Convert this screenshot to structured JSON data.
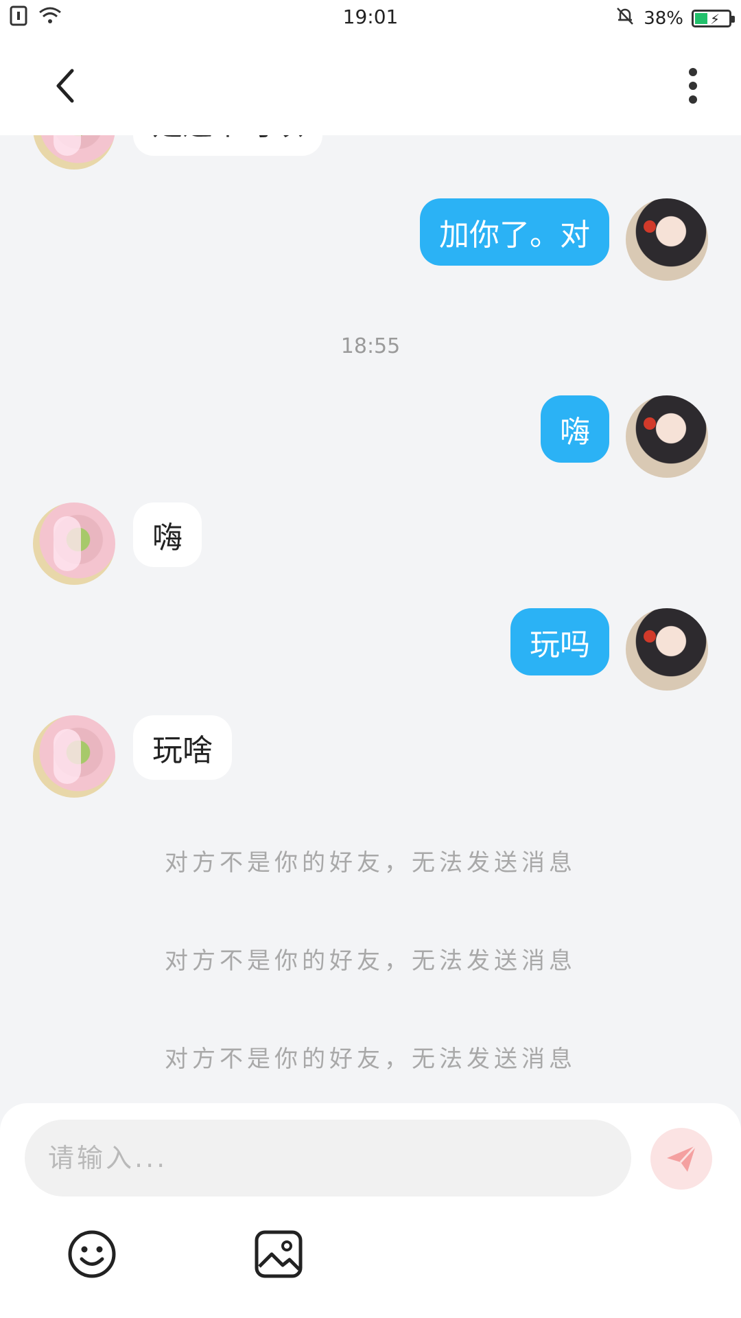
{
  "status_bar": {
    "time": "19:01",
    "battery_percent": "38%",
    "battery_level": 0.38,
    "icons": [
      "sim-icon",
      "wifi-icon",
      "bell-muted-icon",
      "battery-charging-icon"
    ]
  },
  "nav": {
    "back_icon": "back-arrow-icon",
    "more_icon": "more-vertical-icon"
  },
  "messages": [
    {
      "side": "peer",
      "text": "是这个可以",
      "partial": true
    },
    {
      "side": "me",
      "text": "加你了。对"
    },
    {
      "type": "timestamp",
      "text": "18:55"
    },
    {
      "side": "me",
      "text": "嗨"
    },
    {
      "side": "peer",
      "text": "嗨"
    },
    {
      "side": "me",
      "text": "玩吗"
    },
    {
      "side": "peer",
      "text": "玩啥"
    },
    {
      "type": "system",
      "text": "对方不是你的好友，无法发送消息"
    },
    {
      "type": "system",
      "text": "对方不是你的好友，无法发送消息"
    },
    {
      "type": "system",
      "text": "对方不是你的好友，无法发送消息"
    }
  ],
  "composer": {
    "placeholder": "请输入...",
    "send_icon": "send-icon",
    "emoji_icon": "emoji-icon",
    "image_icon": "image-icon",
    "send_color": "#f4a0a0"
  },
  "colors": {
    "my_bubble": "#2bb2f5",
    "peer_bubble": "#ffffff",
    "background": "#f3f4f6"
  }
}
